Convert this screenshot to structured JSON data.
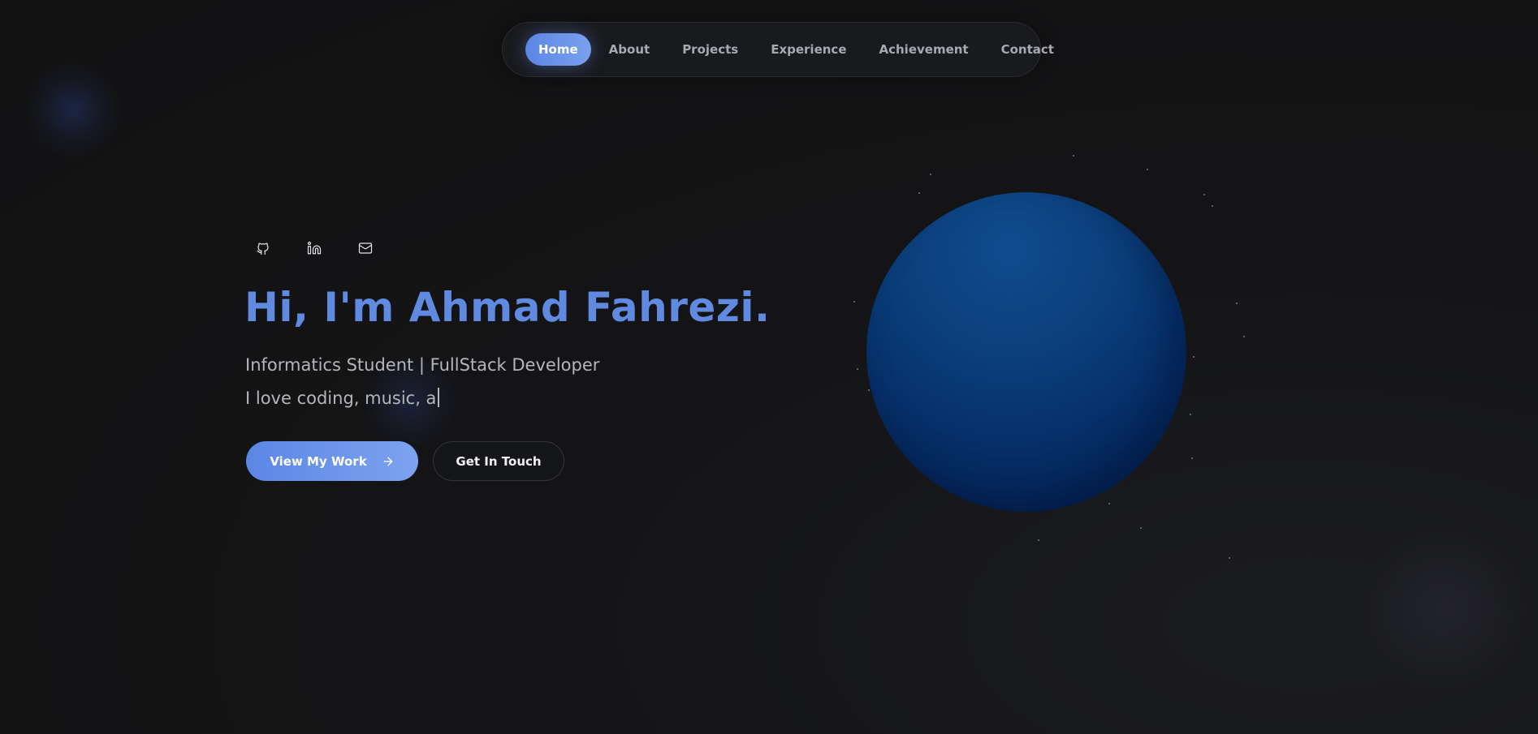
{
  "nav": {
    "items": [
      {
        "label": "Home",
        "active": true
      },
      {
        "label": "About",
        "active": false
      },
      {
        "label": "Projects",
        "active": false
      },
      {
        "label": "Experience",
        "active": false
      },
      {
        "label": "Achievement",
        "active": false
      },
      {
        "label": "Contact",
        "active": false
      }
    ]
  },
  "socials": [
    {
      "icon": "github-icon"
    },
    {
      "icon": "linkedin-icon"
    },
    {
      "icon": "mail-icon"
    }
  ],
  "hero": {
    "title": "Hi, I'm Ahmad Fahrezi.",
    "subtitle": "Informatics Student | FullStack Developer",
    "typing_text": "I love coding, music, a",
    "primary_button": "View My Work",
    "secondary_button": "Get In Touch"
  },
  "colors": {
    "background": "#131314",
    "accent": "#5b86e5",
    "title": "#5f8ae0",
    "planet": "#0b3f7a"
  }
}
